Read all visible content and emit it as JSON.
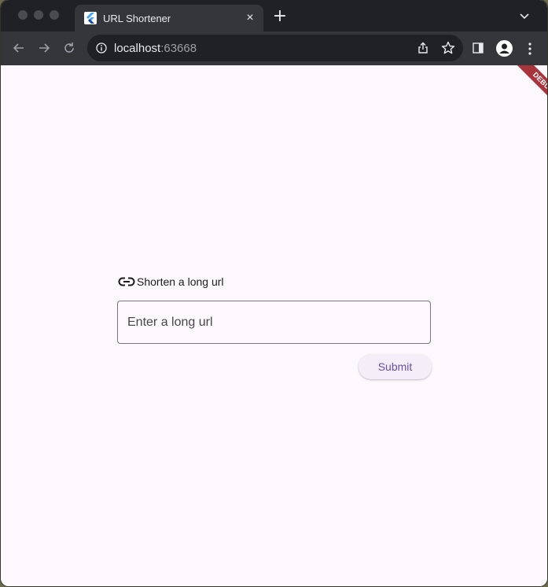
{
  "browser": {
    "tab_title": "URL Shortener",
    "tab_close_label": "×",
    "new_tab_label": "+",
    "address": {
      "host": "localhost",
      "port": ":63668"
    }
  },
  "app": {
    "debug_label": "DEBUG",
    "heading": "Shorten a long url",
    "input": {
      "placeholder": "Enter a long url",
      "value": ""
    },
    "submit_label": "Submit"
  },
  "colors": {
    "accent": "#6750a4",
    "debug_banner": "#a8353c",
    "page_background": "#fdf8fd"
  },
  "icons": {
    "favicon": "flutter-icon",
    "heading_icon": "link-icon"
  }
}
